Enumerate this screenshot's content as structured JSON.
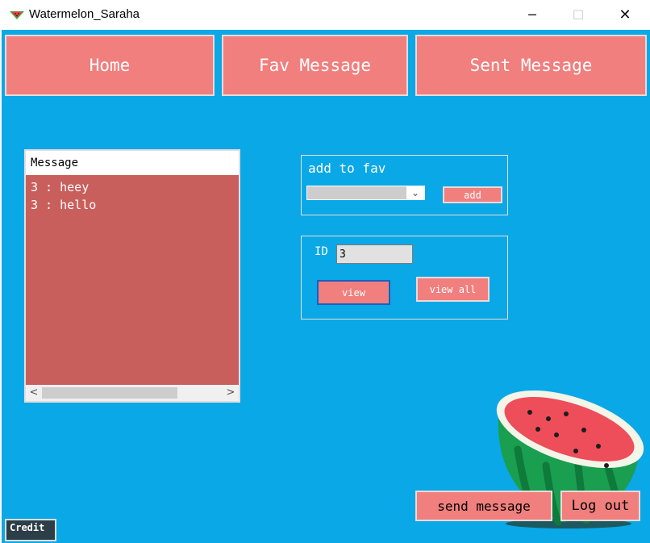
{
  "window": {
    "title": "Watermelon_Saraha",
    "icon": "watermelon-icon",
    "controls": {
      "minimize": "─",
      "maximize": "☐",
      "close": "✕"
    }
  },
  "nav": {
    "home": "Home",
    "fav_message": "Fav Message",
    "sent_message": "Sent Message"
  },
  "messages": {
    "header": "Message",
    "items": [
      "3 : heey",
      "3 : hello"
    ]
  },
  "fav_panel": {
    "label": "add to fav",
    "select_value": "",
    "add_button": "add"
  },
  "id_panel": {
    "label": "ID",
    "id_value": "3",
    "view_button": "view",
    "view_all_button": "view all"
  },
  "footer": {
    "send_message": "send message",
    "log_out": "Log out",
    "credit": "Credit"
  },
  "colors": {
    "background": "#0aa8e6",
    "button": "#f07f7e",
    "list": "#c95f5c",
    "credit": "#2d3e48"
  }
}
